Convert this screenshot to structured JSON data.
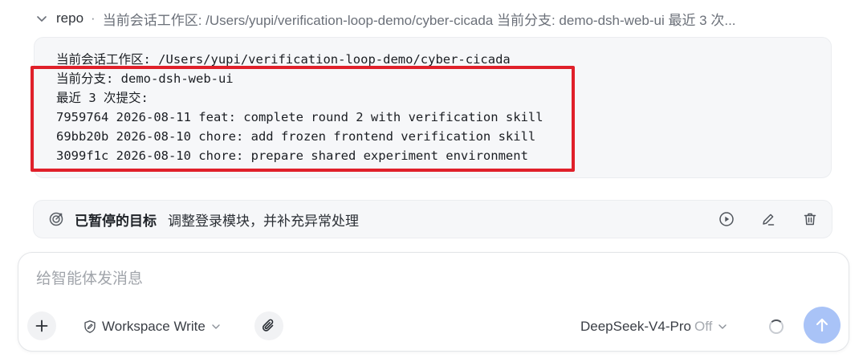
{
  "header": {
    "repo_label": "repo",
    "separator": "·",
    "summary": "当前会话工作区: /Users/yupi/verification-loop-demo/cyber-cicada 当前分支: demo-dsh-web-ui 最近 3 次..."
  },
  "code_block": {
    "lines": [
      "当前会话工作区: /Users/yupi/verification-loop-demo/cyber-cicada",
      "当前分支: demo-dsh-web-ui",
      "最近 3 次提交:",
      "7959764 2026-08-11 feat: complete round 2 with verification skill",
      "69bb20b 2026-08-10 chore: add frozen frontend verification skill",
      "3099f1c 2026-08-10 chore: prepare shared experiment environment"
    ],
    "highlight_color": "#e0202a"
  },
  "goal": {
    "title": "已暂停的目标",
    "text": "调整登录模块，并补充异常处理",
    "icons": [
      "target-icon",
      "play-circle-icon",
      "edit-pencil-icon",
      "trash-icon"
    ]
  },
  "composer": {
    "placeholder": "给智能体发消息",
    "value": "",
    "mode_label": "Workspace Write",
    "model_name": "DeepSeek-V4-Pro",
    "model_thinking": "Off",
    "send_color": "#a9c3f7"
  }
}
